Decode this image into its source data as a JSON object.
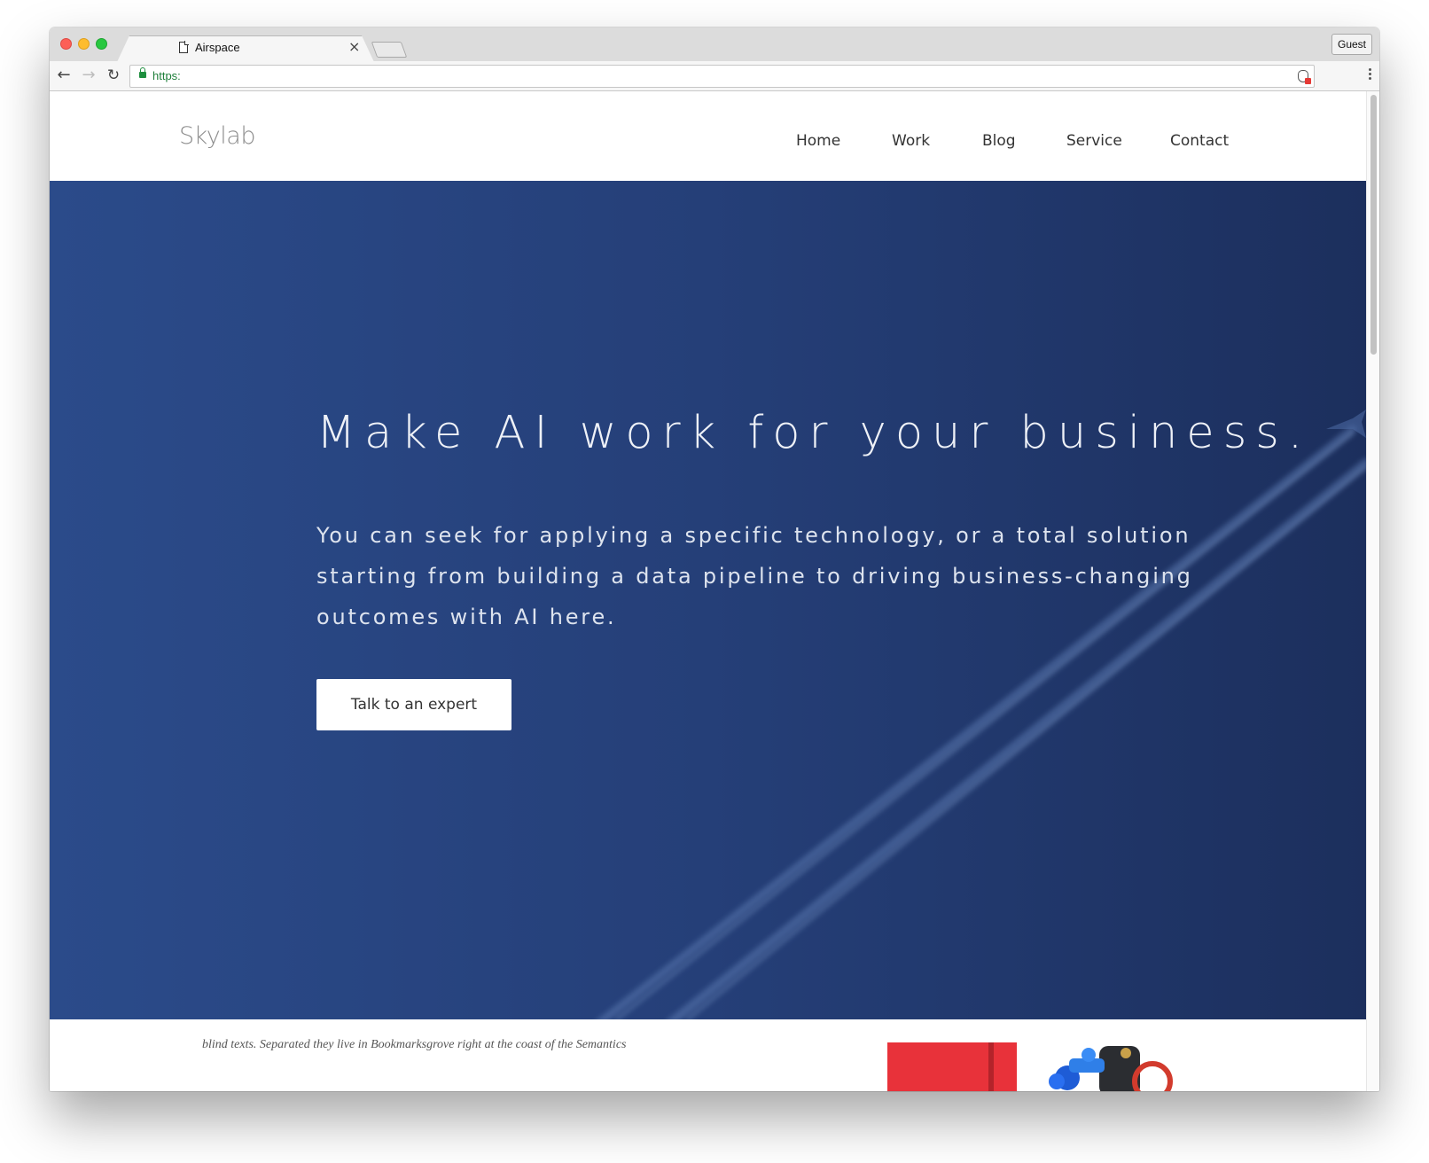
{
  "browser": {
    "tab_title": "Airspace",
    "tab_close": "×",
    "guest_label": "Guest",
    "url": "https:",
    "icons": {
      "back": "arrow-left-icon",
      "forward": "arrow-right-icon",
      "reload": "reload-icon",
      "lock": "lock-icon",
      "extension": "shield-icon",
      "menu": "kebab-menu-icon"
    }
  },
  "site": {
    "logo": "Skylab",
    "nav": [
      "Home",
      "Work",
      "Blog",
      "Service",
      "Contact"
    ]
  },
  "hero": {
    "title": "Make AI work for your business.",
    "body": "You can seek for applying a specific technology, or a total solution starting from building a data pipeline to driving business-changing outcomes with AI here.",
    "cta": "Talk to an expert"
  },
  "below": {
    "text": "blind texts. Separated they live in Bookmarksgrove right at the coast of the Semantics"
  },
  "colors": {
    "hero_start": "#2b4b8a",
    "hero_end": "#1c2f5d",
    "secure_green": "#1e7f3a"
  }
}
